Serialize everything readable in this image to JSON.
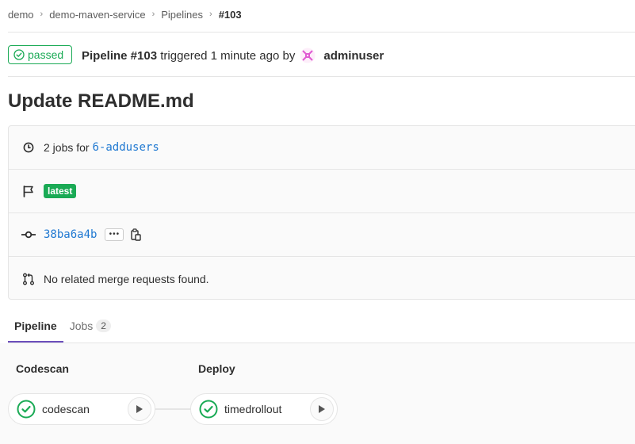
{
  "breadcrumb": {
    "items": [
      "demo",
      "demo-maven-service",
      "Pipelines"
    ],
    "current": "#103"
  },
  "header": {
    "status": "passed",
    "pipeline_label": "Pipeline #103",
    "triggered_text": "triggered",
    "time_ago": "1 minute ago",
    "by_text": "by",
    "username": "adminuser"
  },
  "commit_title": "Update README.md",
  "info": {
    "jobs_text": "2 jobs for",
    "branch": "6-addusers",
    "latest_badge": "latest",
    "commit_sha": "38ba6a4b",
    "ellipsis": "•••",
    "merge_requests_text": "No related merge requests found."
  },
  "tabs": [
    {
      "label": "Pipeline"
    },
    {
      "label": "Jobs",
      "count": "2"
    }
  ],
  "stages": [
    {
      "title": "Codescan",
      "job": "codescan",
      "status": "success"
    },
    {
      "title": "Deploy",
      "job": "timedrollout",
      "status": "success"
    }
  ],
  "colors": {
    "success": "#1aaa55",
    "link": "#1f78d1",
    "tab_active": "#6b4fbb"
  }
}
